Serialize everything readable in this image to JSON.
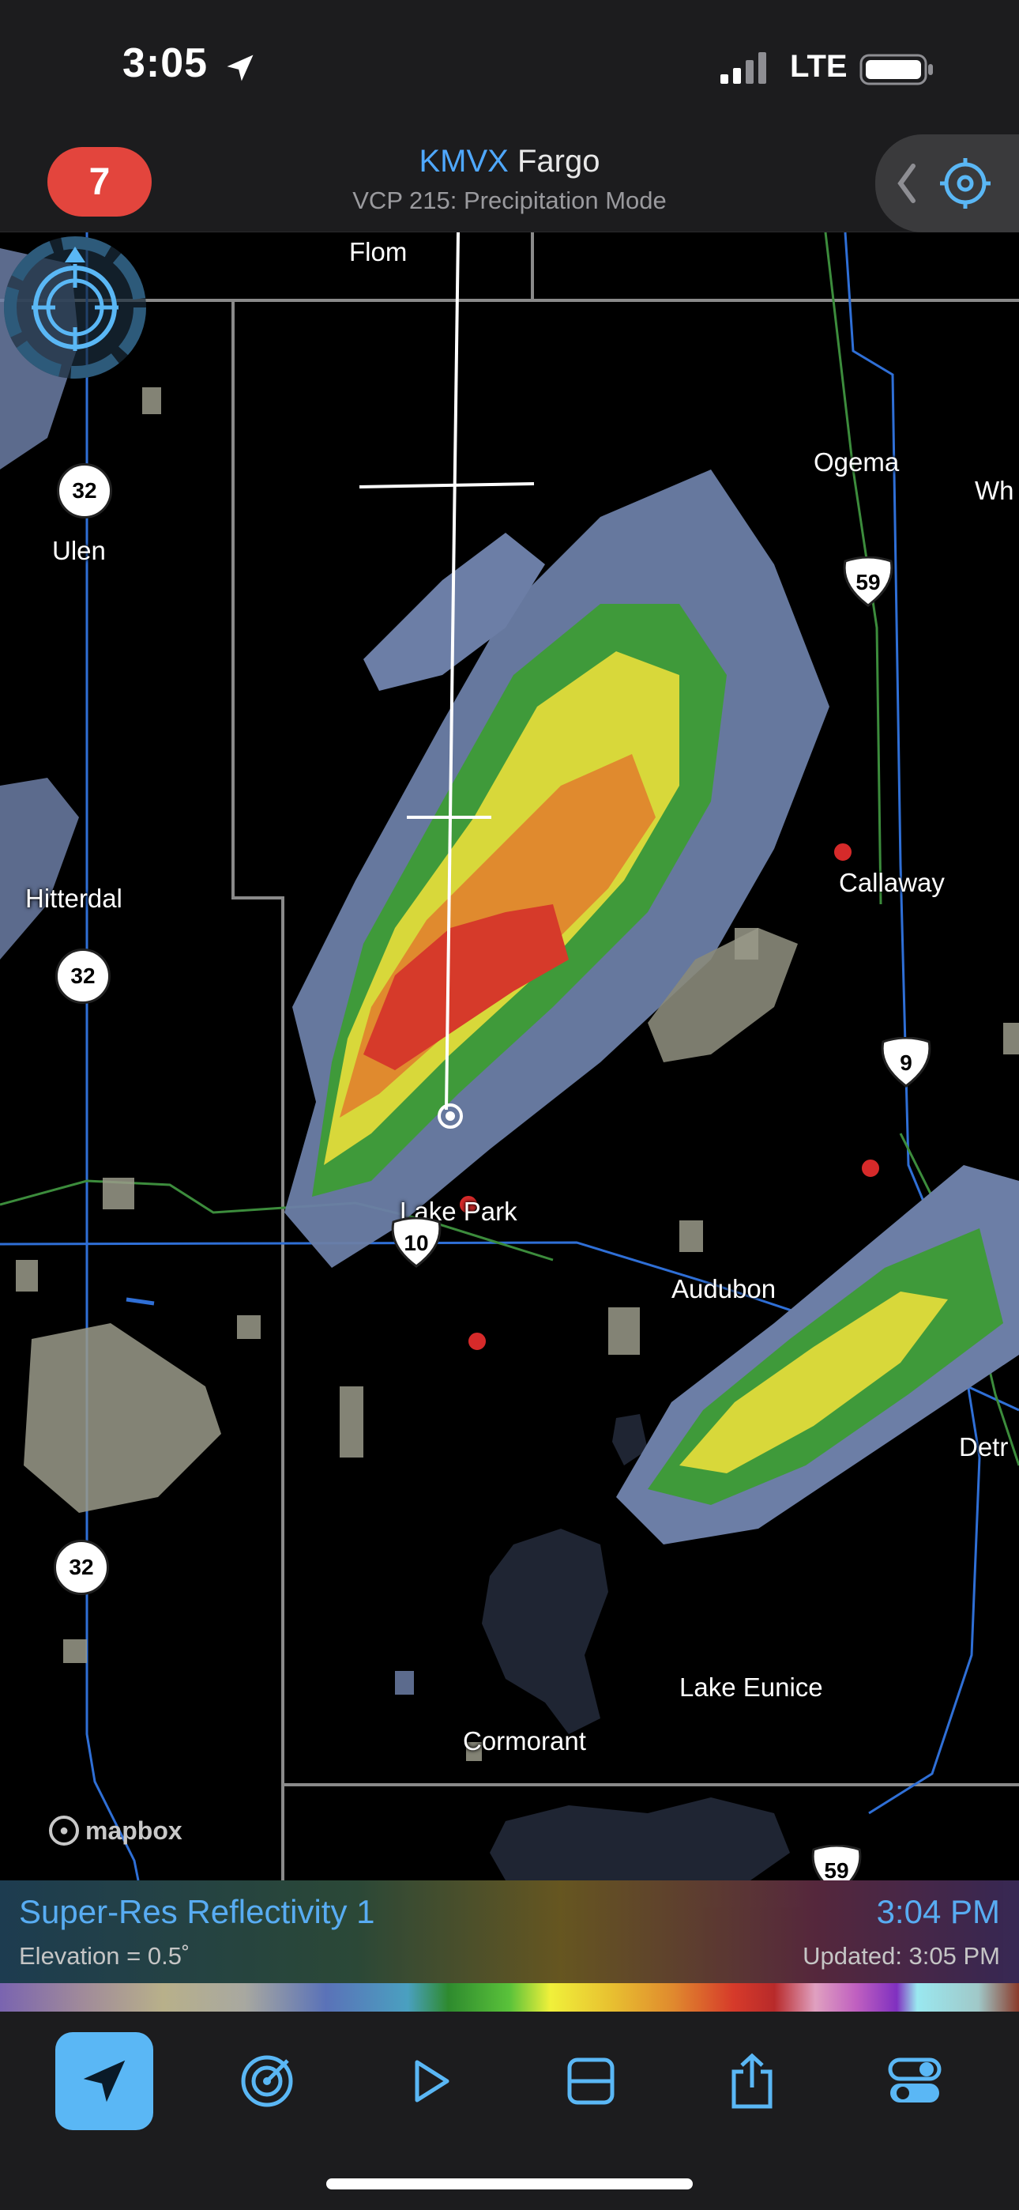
{
  "status_bar": {
    "time": "3:05",
    "network": "LTE",
    "icons": [
      "location-arrow-icon",
      "signal-icon",
      "battery-icon"
    ]
  },
  "header": {
    "alert_count": "7",
    "station_id": "KMVX",
    "station_city": "Fargo",
    "vcp": "VCP 215: Precipitation Mode",
    "icons": [
      "chevron-left-icon",
      "target-icon"
    ]
  },
  "map": {
    "places": {
      "flom": "Flom",
      "ogema": "Ogema",
      "wh": "Wh",
      "ulen": "Ulen",
      "hitterdal": "Hitterdal",
      "callaway": "Callaway",
      "lake_park": "Lake Park",
      "audubon": "Audubon",
      "detr": "Detr",
      "lake_eunice": "Lake Eunice",
      "cormorant": "Cormorant"
    },
    "route_shields": {
      "mn32_a": "32",
      "mn32_b": "32",
      "mn32_c": "32",
      "us59_a": "59",
      "us59_b": "9",
      "us59_c": "59",
      "us10": "10"
    },
    "attribution": "mapbox"
  },
  "product": {
    "name": "Super-Res Reflectivity 1",
    "elevation": "Elevation = 0.5˚",
    "scan_time": "3:04 PM",
    "updated": "Updated: 3:05 PM"
  },
  "colors": {
    "accent": "#5ab7f5",
    "alert": "#e3453d",
    "station": "#4fa8ff"
  },
  "toolbar": {
    "icons": [
      "location-arrow-icon",
      "radar-icon",
      "play-icon",
      "layers-icon",
      "share-icon",
      "settings-toggle-icon"
    ]
  }
}
